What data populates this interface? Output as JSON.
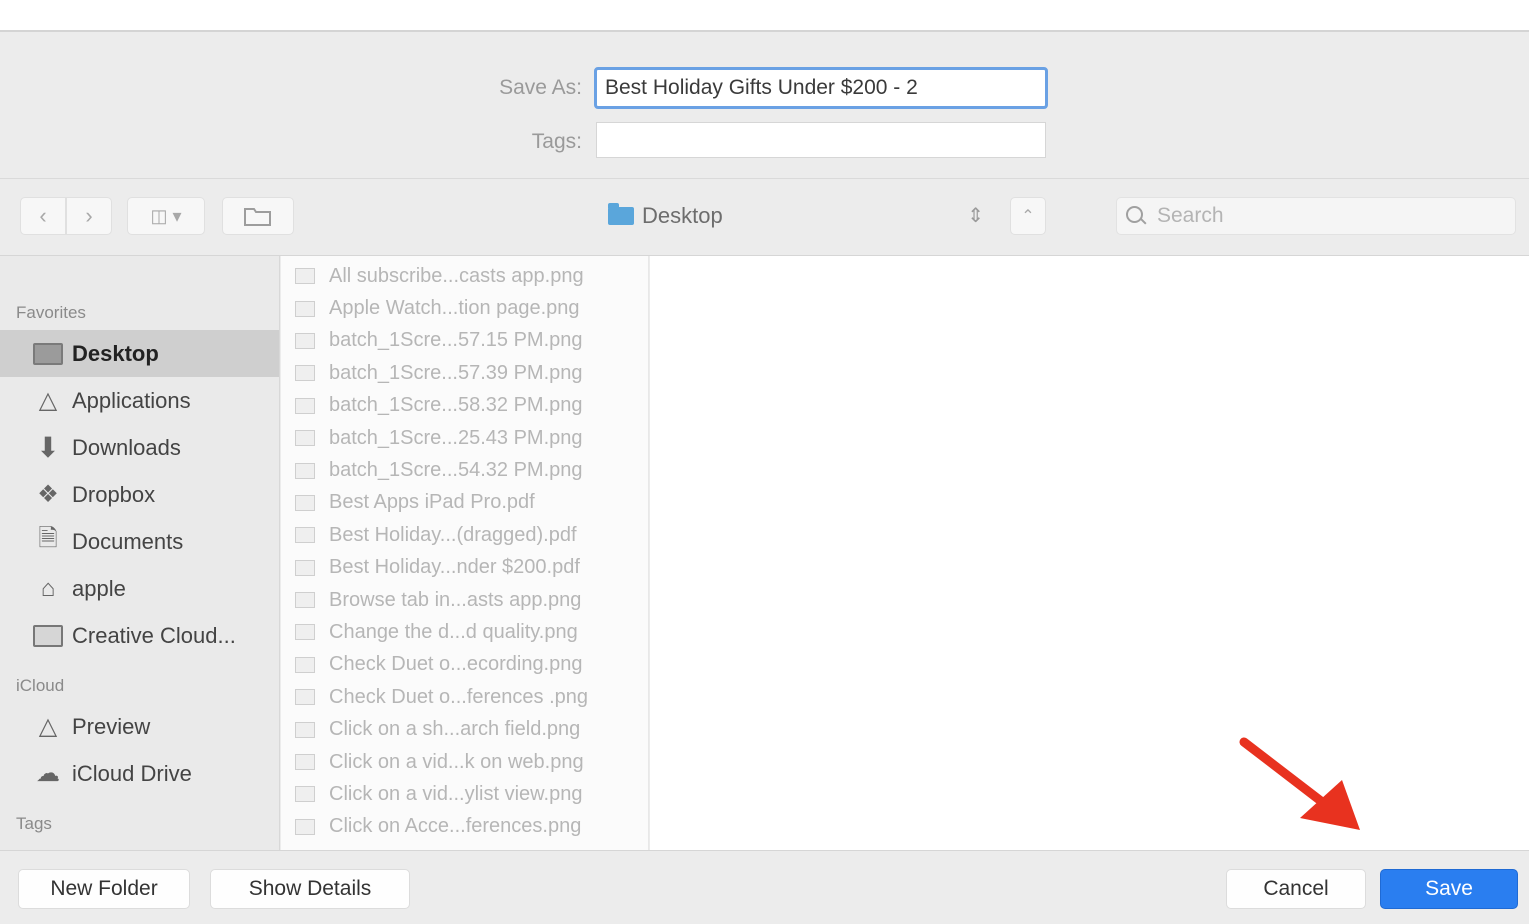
{
  "header": {
    "save_as_label": "Save As:",
    "save_as_value": "Best Holiday Gifts Under $200 - 2",
    "tags_label": "Tags:",
    "tags_value": ""
  },
  "toolbar": {
    "back_icon": "chevron-left-icon",
    "forward_icon": "chevron-right-icon",
    "view_icon": "column-view-icon",
    "new_folder_icon": "folder-outline-icon",
    "location": "Desktop",
    "collapse_icon": "chevron-up-icon",
    "search_placeholder": "Search"
  },
  "sidebar": {
    "sections": [
      {
        "title": "Favorites",
        "items": [
          {
            "label": "Desktop",
            "icon": "desktop-folder-icon",
            "selected": true
          },
          {
            "label": "Applications",
            "icon": "applications-icon"
          },
          {
            "label": "Downloads",
            "icon": "downloads-icon"
          },
          {
            "label": "Dropbox",
            "icon": "dropbox-icon"
          },
          {
            "label": "Documents",
            "icon": "documents-icon"
          },
          {
            "label": "apple",
            "icon": "home-icon"
          },
          {
            "label": "Creative Cloud...",
            "icon": "folder-icon"
          }
        ]
      },
      {
        "title": "iCloud",
        "items": [
          {
            "label": "Preview",
            "icon": "preview-icon"
          },
          {
            "label": "iCloud Drive",
            "icon": "cloud-icon"
          }
        ]
      },
      {
        "title": "Tags",
        "items": []
      }
    ]
  },
  "files": [
    "All subscribe...casts app.png",
    "Apple Watch...tion page.png",
    "batch_1Scre...57.15 PM.png",
    "batch_1Scre...57.39 PM.png",
    "batch_1Scre...58.32 PM.png",
    "batch_1Scre...25.43 PM.png",
    "batch_1Scre...54.32 PM.png",
    "Best Apps iPad Pro.pdf",
    "Best Holiday...(dragged).pdf",
    "Best Holiday...nder $200.pdf",
    "Browse tab in...asts app.png",
    "Change the d...d quality.png",
    "Check Duet o...ecording.png",
    "Check Duet o...ferences .png",
    "Click on a sh...arch field.png",
    "Click on a vid...k on web.png",
    "Click on a vid...ylist view.png",
    "Click on Acce...ferences.png"
  ],
  "footer": {
    "new_folder": "New Folder",
    "show_details": "Show Details",
    "cancel": "Cancel",
    "save": "Save"
  },
  "colors": {
    "accent": "#2a7ef0",
    "focus_ring": "#6aa1e4",
    "annotation_arrow": "#e8321f"
  }
}
